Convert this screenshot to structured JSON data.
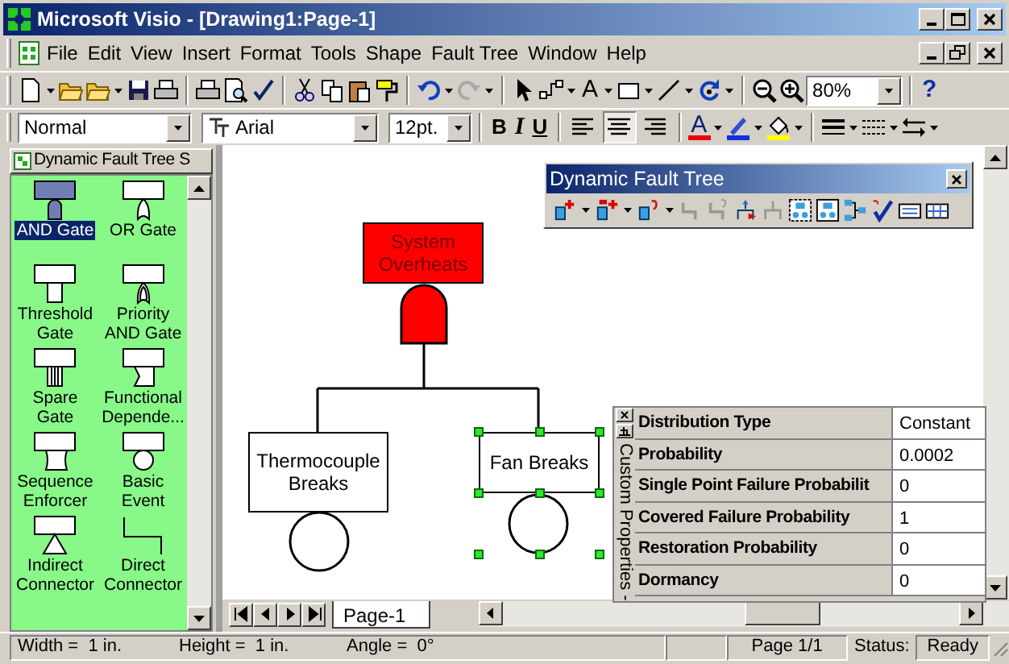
{
  "window": {
    "title": "Microsoft Visio - [Drawing1:Page-1]"
  },
  "menu": [
    {
      "label": "File"
    },
    {
      "label": "Edit"
    },
    {
      "label": "View"
    },
    {
      "label": "Insert"
    },
    {
      "label": "Format"
    },
    {
      "label": "Tools"
    },
    {
      "label": "Shape"
    },
    {
      "label": "Fault Tree"
    },
    {
      "label": "Window"
    },
    {
      "label": "Help"
    }
  ],
  "toolbar": {
    "text_tool": "A",
    "zoom": "80%",
    "help": "?"
  },
  "format_bar": {
    "style": "Normal",
    "font": "Arial",
    "size": "12pt.",
    "bold": "B",
    "italic": "I",
    "underline": "U",
    "font_color": "A",
    "alignment": [
      {
        "kind": "left",
        "selected": false
      },
      {
        "kind": "center",
        "selected": true
      },
      {
        "kind": "right",
        "selected": false
      }
    ]
  },
  "stencil": {
    "title": "Dynamic Fault Tree S",
    "items": [
      {
        "label": "AND Gate",
        "kind": "and",
        "selected": true
      },
      {
        "label": "OR Gate",
        "kind": "or",
        "selected": false
      },
      {
        "label": "Threshold Gate",
        "kind": "threshold",
        "selected": false
      },
      {
        "label": "Priority AND Gate",
        "kind": "priority",
        "selected": false
      },
      {
        "label": "Spare Gate",
        "kind": "spare",
        "selected": false
      },
      {
        "label": "Functional Depende...",
        "kind": "fdep",
        "selected": false
      },
      {
        "label": "Sequence Enforcer",
        "kind": "seq",
        "selected": false
      },
      {
        "label": "Basic Event",
        "kind": "basic",
        "selected": false
      },
      {
        "label": "Indirect Connector",
        "kind": "indirect",
        "selected": false
      },
      {
        "label": "Direct Connector",
        "kind": "direct",
        "selected": false
      }
    ]
  },
  "fault_tree_toolbar": {
    "title": "Dynamic Fault Tree"
  },
  "diagram": {
    "top_event": {
      "label": "System Overheats"
    },
    "events": [
      {
        "label": "Thermocouple Breaks",
        "selected": false
      },
      {
        "label": "Fan Breaks",
        "selected": true
      }
    ]
  },
  "properties": {
    "title": "Custom Properties -",
    "rows": [
      {
        "name": "Distribution Type",
        "value": "Constant"
      },
      {
        "name": "Probability",
        "value": "0.0002"
      },
      {
        "name": "Single Point Failure Probabilit",
        "value": "0"
      },
      {
        "name": "Covered Failure Probability",
        "value": "1"
      },
      {
        "name": "Restoration Probability",
        "value": "0"
      },
      {
        "name": "Dormancy",
        "value": "0"
      }
    ]
  },
  "page_tabs": [
    {
      "label": "Page-1",
      "selected": true
    }
  ],
  "status_bar": {
    "width": "Width =  1 in.",
    "height": "Height =  1 in.",
    "angle": "Angle =  0°",
    "page": "Page 1/1",
    "status_label": "Status:",
    "status": "Ready"
  }
}
